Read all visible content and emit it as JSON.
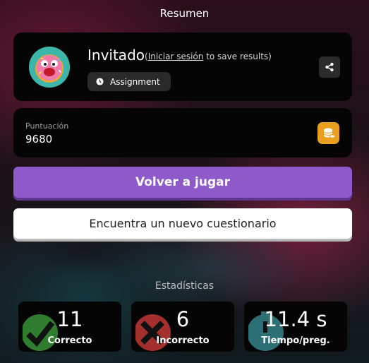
{
  "header": {
    "title": "Resumen"
  },
  "profile": {
    "name": "Invitado",
    "login_prefix": "(",
    "login_link": "Iniciar sesión",
    "login_suffix": " to save results)",
    "assignment_label": "Assignment",
    "avatar_icon": "donut-avatar-icon",
    "share_icon": "share-icon"
  },
  "score": {
    "label": "Puntuación",
    "value": "9680",
    "icon": "coins-icon"
  },
  "actions": {
    "play_again": "Volver a jugar",
    "find_quiz": "Encuentra un nuevo cuestionario"
  },
  "stats": {
    "heading": "Estadísticas",
    "items": [
      {
        "value": "11",
        "label": "Correcto",
        "icon": "check-icon",
        "color": "#2f7d2f"
      },
      {
        "value": "6",
        "label": "Incorrecto",
        "icon": "cross-icon",
        "color": "#a3302c"
      },
      {
        "value": "11.4 s",
        "label": "Tiempo/preg.",
        "icon": "timer-icon",
        "color": "#2c6f74"
      }
    ]
  },
  "colors": {
    "primary": "#8e5ac9",
    "coin": "#e8a01e",
    "card": "#050505"
  }
}
